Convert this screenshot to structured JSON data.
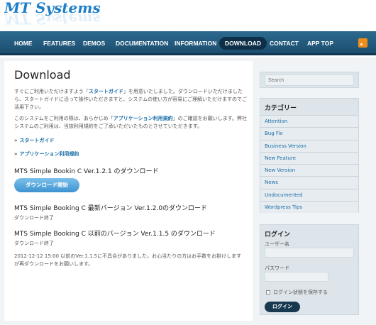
{
  "site": {
    "logo": "MT Systems"
  },
  "nav": {
    "items": [
      {
        "label": "HOME"
      },
      {
        "label": "FEATURES"
      },
      {
        "label": "DEMOS"
      },
      {
        "label": "DOCUMENTATION"
      },
      {
        "label": "INFORMATION"
      },
      {
        "label": "DOWNLOAD"
      },
      {
        "label": "CONTACT"
      },
      {
        "label": "APP TOP"
      }
    ]
  },
  "main": {
    "title": "Download",
    "intro1": {
      "pre": "すぐにご利用いただけますよう「",
      "link": "スタートガイド",
      "post": "」を用意いたしました。ダウンロードいただけましたら、スタートガイドに沿って操作いただきますと、システムの使い方が容易にご理解いただけますのでご活用下さい。"
    },
    "intro2": {
      "pre": "このシステムをご利用の際は、あらかじめ「",
      "link": "アプリケーション利用規約",
      "post": "」のご確認をお願いします。弊社システムのご利用は、当該利用規約をご了承いただいたものとさせていただきます。"
    },
    "links": [
      {
        "mark": "»",
        "label": "スタートガイド"
      },
      {
        "mark": "»",
        "label": "アプリケーション利用規約"
      }
    ],
    "section1": {
      "heading": "MTS Simple Bookin C Ver.1.2.1 のダウンロード",
      "button": "ダウンロード開始"
    },
    "section2": {
      "heading": "MTS Simple Booking C 最新バージョン Ver.1.2.0のダウンロード",
      "status": "ダウンロード終了"
    },
    "section3": {
      "heading": "MTS Simple Booking C 以前のバージョン Ver.1.1.5 のダウンロード",
      "status": "ダウンロード終了"
    },
    "note": "2012-12-12 15:00 以前のVer.1.1.5に不具合がありました。お心当たりの方はお手数をお掛けしますが再ダウンロードをお願いします。"
  },
  "sidebar": {
    "search": {
      "placeholder": "Search"
    },
    "categories": {
      "title": "カテゴリー",
      "items": [
        "Attention",
        "Bug Fix",
        "Business Version",
        "New Feature",
        "New Version",
        "News",
        "Undocumented",
        "Wordpress Tips"
      ]
    },
    "login": {
      "title": "ログイン",
      "username_label": "ユーザー名",
      "password_label": "パスワード",
      "remember_label": "ログイン状態を保存する",
      "button": "ログイン"
    }
  },
  "colors": {
    "nav_bg": "#1b4d6e",
    "link": "#1a6ea8",
    "logo": "#1e7ec8",
    "button": "#3d93d0"
  }
}
